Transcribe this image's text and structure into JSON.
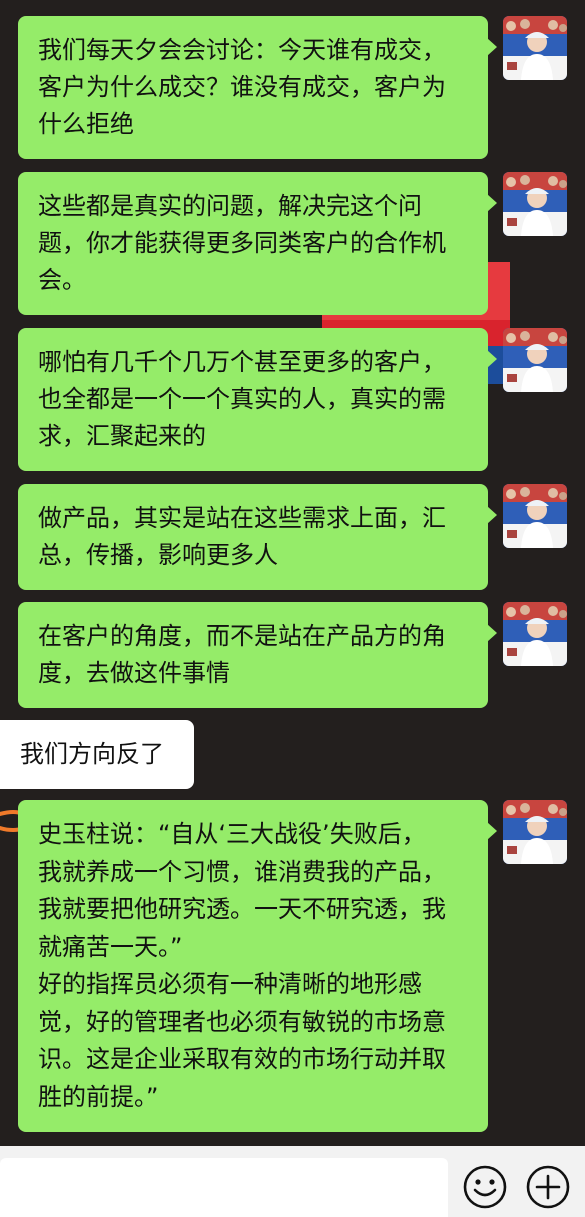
{
  "chat": {
    "messages": [
      {
        "side": "out",
        "lines": [
          "我们每天夕会会讨论：今天谁有成交，",
          "客户为什么成交？谁没有成交，客户为",
          "什么拒绝"
        ]
      },
      {
        "side": "out",
        "lines": [
          "这些都是真实的问题，解决完这个问",
          "题，你才能获得更多同类客户的合作机",
          "会。"
        ]
      },
      {
        "side": "out",
        "lines": [
          "哪怕有几千个几万个甚至更多的客户，",
          "也全都是一个一个真实的人，真实的需",
          "求，汇聚起来的"
        ]
      },
      {
        "side": "out",
        "lines": [
          "做产品，其实是站在这些需求上面，汇",
          "总，传播，影响更多人"
        ]
      },
      {
        "side": "out",
        "lines": [
          "在客户的角度，而不是站在产品方的角",
          "度，去做这件事情"
        ]
      },
      {
        "side": "in",
        "lines": [
          "我们方向反了"
        ]
      },
      {
        "side": "out",
        "lines": [
          "史玉柱说：“自从‘三大战役’失败后，",
          "我就养成一个习惯，谁消费我的产品，",
          "我就要把他研究透。一天不研究透，我",
          "就痛苦一天。”",
          "好的指挥员必须有一种清晰的地形感",
          "觉，好的管理者也必须有敏锐的市场意",
          "识。这是企业采取有效的市场行动并取",
          "胜的前提。”"
        ]
      }
    ]
  },
  "colors": {
    "background": "#231f1e",
    "outgoing_bubble": "#95ec69",
    "incoming_bubble": "#ffffff",
    "input_bar": "#f2f2f2"
  },
  "input_bar": {
    "emoji_icon": "smile-icon",
    "plus_icon": "plus-icon"
  }
}
